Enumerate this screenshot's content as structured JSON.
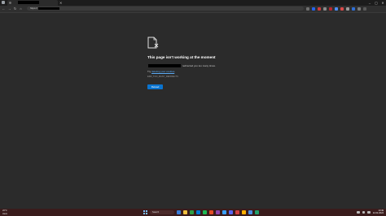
{
  "browser": {
    "tab_title": "",
    "tab_close": "✕",
    "caption": {
      "minimize": "–",
      "maximize": "▢",
      "close": "✕"
    },
    "address_prefix": "https://",
    "extension_colors": [
      "#6f6f6f",
      "#2563eb",
      "#d03b3b",
      "#8a8a8a",
      "#b8262e",
      "#4c8ef5",
      "#d94a4a",
      "#9a9a9a",
      "#2f6fd6",
      "#7a7a7a",
      "#5a5a5a"
    ]
  },
  "error_page": {
    "heading": "This page isn't working at the moment",
    "line1_suffix": "redirected you too many times.",
    "line2_prefix": "Try ",
    "line2_link": "deleting your cookies",
    "line2_suffix": ".",
    "error_code": "ERR_TOO_MANY_REDIRECTS",
    "reload_label": "Reload"
  },
  "taskbar": {
    "weather_temp": "26°C",
    "weather_desc": "Haze",
    "search_placeholder": "Search",
    "app_colors": [
      "#3a7bd5",
      "#f0c040",
      "#2ea043",
      "#0078d4",
      "#1db954",
      "#e34c26",
      "#8e44ad",
      "#3aa0ff",
      "#5865f2",
      "#d04040",
      "#ffb000",
      "#4a90e2",
      "#22a06b"
    ],
    "clock_time": "13:49",
    "clock_date": "12-02-2024"
  }
}
